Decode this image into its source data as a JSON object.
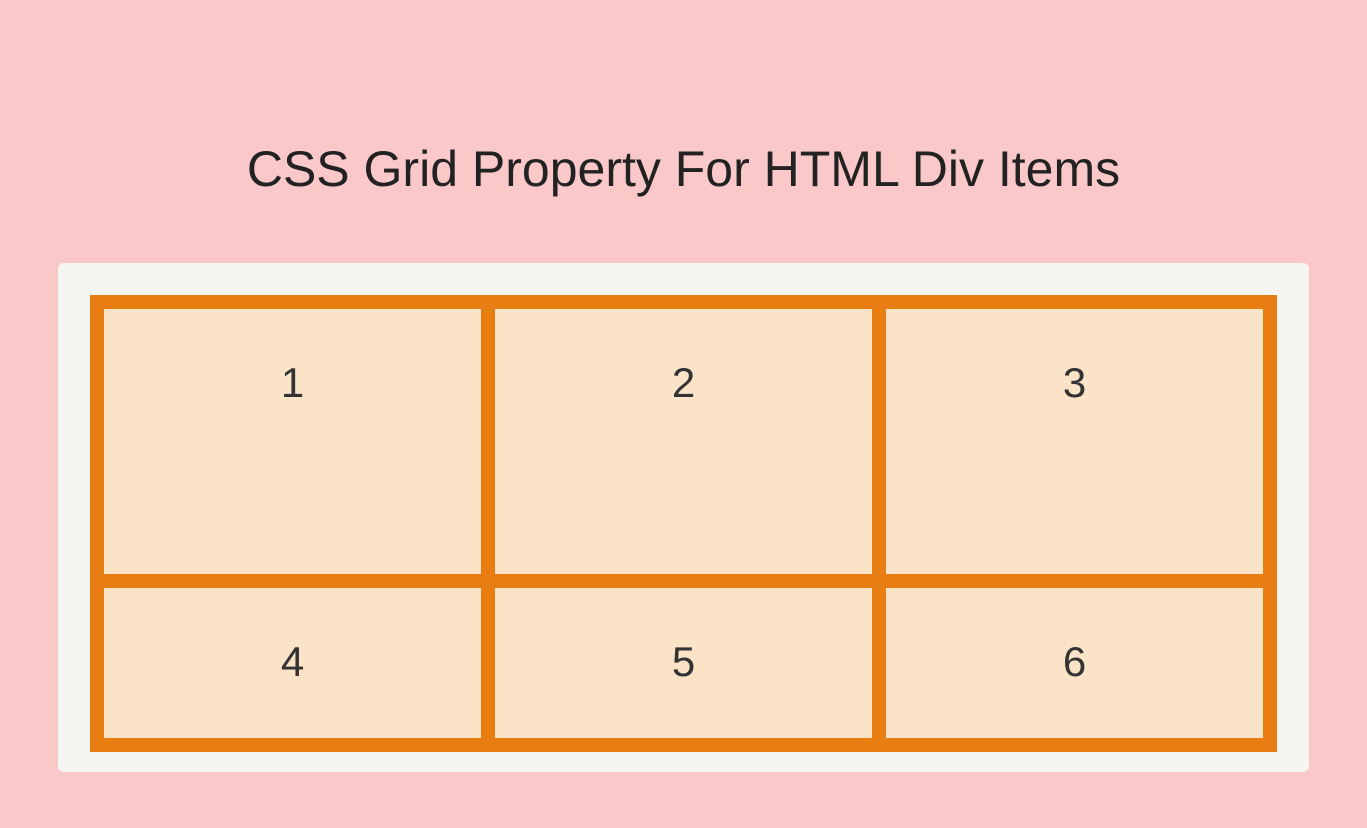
{
  "title": "CSS Grid Property For HTML Div Items",
  "grid": {
    "items": [
      {
        "label": "1"
      },
      {
        "label": "2"
      },
      {
        "label": "3"
      },
      {
        "label": "4"
      },
      {
        "label": "5"
      },
      {
        "label": "6"
      }
    ]
  },
  "colors": {
    "page_bg": "#fac8c8",
    "panel_bg": "#f7f5f2",
    "grid_border": "#e87e12",
    "cell_bg": "#fae3c7"
  }
}
